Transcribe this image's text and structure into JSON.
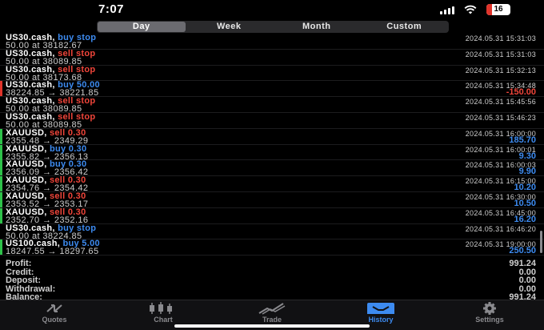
{
  "status": {
    "time": "7:07",
    "battery": "16"
  },
  "segments": [
    {
      "label": "Day",
      "active": true
    },
    {
      "label": "Week",
      "active": false
    },
    {
      "label": "Month",
      "active": false
    },
    {
      "label": "Custom",
      "active": false
    }
  ],
  "deals": [
    {
      "symbol": "US30.cash,",
      "side": "buy stop",
      "side_type": "buy",
      "detail": "50.00 at 38182.67",
      "time": "2024.05.31 15:31:03",
      "amount": "",
      "marker": ""
    },
    {
      "symbol": "US30.cash,",
      "side": "sell stop",
      "side_type": "sell",
      "detail": "50.00 at 38089.85",
      "time": "2024.05.31 15:31:03",
      "amount": "",
      "marker": ""
    },
    {
      "symbol": "US30.cash,",
      "side": "sell stop",
      "side_type": "sell",
      "detail": "50.00 at 38173.68",
      "time": "2024.05.31 15:32:13",
      "amount": "",
      "marker": ""
    },
    {
      "symbol": "US30.cash,",
      "side": "buy 50.00",
      "side_type": "buy",
      "detail": "38224.85 → 38221.85",
      "time": "2024.05.31 15:34:48",
      "amount": "-150.00",
      "amount_type": "neg",
      "marker": "red"
    },
    {
      "symbol": "US30.cash,",
      "side": "sell stop",
      "side_type": "sell",
      "detail": "50.00 at 38089.85",
      "time": "2024.05.31 15:45:56",
      "amount": "",
      "marker": ""
    },
    {
      "symbol": "US30.cash,",
      "side": "sell stop",
      "side_type": "sell",
      "detail": "50.00 at 38089.85",
      "time": "2024.05.31 15:46:23",
      "amount": "",
      "marker": ""
    },
    {
      "symbol": "XAUUSD,",
      "side": "sell 0.30",
      "side_type": "sell",
      "detail": "2355.48 → 2349.29",
      "time": "2024.05.31 16:00:00",
      "amount": "185.70",
      "amount_type": "pos",
      "marker": "green"
    },
    {
      "symbol": "XAUUSD,",
      "side": "buy 0.30",
      "side_type": "buy",
      "detail": "2355.82 → 2356.13",
      "time": "2024.05.31 16:00:01",
      "amount": "9.30",
      "amount_type": "pos",
      "marker": "green"
    },
    {
      "symbol": "XAUUSD,",
      "side": "buy 0.30",
      "side_type": "buy",
      "detail": "2356.09 → 2356.42",
      "time": "2024.05.31 16:00:03",
      "amount": "9.90",
      "amount_type": "pos",
      "marker": "green"
    },
    {
      "symbol": "XAUUSD,",
      "side": "sell 0.30",
      "side_type": "sell",
      "detail": "2354.76 → 2354.42",
      "time": "2024.05.31 16:15:00",
      "amount": "10.20",
      "amount_type": "pos",
      "marker": "green"
    },
    {
      "symbol": "XAUUSD,",
      "side": "sell 0.30",
      "side_type": "sell",
      "detail": "2353.52 → 2353.17",
      "time": "2024.05.31 16:30:00",
      "amount": "10.50",
      "amount_type": "pos",
      "marker": "green"
    },
    {
      "symbol": "XAUUSD,",
      "side": "sell 0.30",
      "side_type": "sell",
      "detail": "2352.70 → 2352.16",
      "time": "2024.05.31 16:45:00",
      "amount": "16.20",
      "amount_type": "pos",
      "marker": "green"
    },
    {
      "symbol": "US30.cash,",
      "side": "buy stop",
      "side_type": "buy",
      "detail": "50.00 at 38224.85",
      "time": "2024.05.31 16:46:20",
      "amount": "",
      "marker": ""
    },
    {
      "symbol": "US100.cash,",
      "side": "buy 5.00",
      "side_type": "buy",
      "detail": "18247.55 → 18297.65",
      "time": "2024.05.31 19:00:00",
      "amount": "250.50",
      "amount_type": "pos",
      "marker": "green"
    }
  ],
  "summary": [
    {
      "label": "Profit:",
      "value": "991.24"
    },
    {
      "label": "Credit:",
      "value": "0.00"
    },
    {
      "label": "Deposit:",
      "value": "0.00"
    },
    {
      "label": "Withdrawal:",
      "value": "0.00"
    },
    {
      "label": "Balance:",
      "value": "991.24"
    }
  ],
  "tabs": [
    {
      "label": "Quotes",
      "icon": "quotes-icon",
      "active": false
    },
    {
      "label": "Chart",
      "icon": "chart-icon",
      "active": false
    },
    {
      "label": "Trade",
      "icon": "trade-icon",
      "active": false
    },
    {
      "label": "History",
      "icon": "history-icon",
      "active": true
    },
    {
      "label": "Settings",
      "icon": "settings-icon",
      "active": false
    }
  ],
  "colors": {
    "buy": "#3d8bf0",
    "sell": "#f0453a",
    "profit_marker": "#2ec24a",
    "loss_marker": "#e0342b"
  }
}
